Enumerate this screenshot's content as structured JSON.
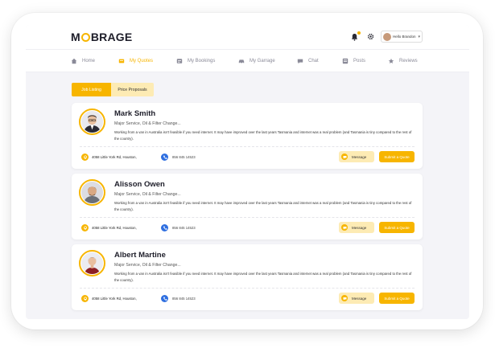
{
  "header": {
    "logo": {
      "part1": "M",
      "part2": "BRAGE"
    },
    "user_label": "Hello Brandon"
  },
  "nav": {
    "items": [
      {
        "label": "Home",
        "icon": "home-icon",
        "active": false
      },
      {
        "label": "My Quotes",
        "icon": "quotes-icon",
        "active": true
      },
      {
        "label": "My Bookings",
        "icon": "bookings-icon",
        "active": false
      },
      {
        "label": "My Garrage",
        "icon": "garage-icon",
        "active": false
      },
      {
        "label": "Chat",
        "icon": "chat-icon",
        "active": false
      },
      {
        "label": "Posts",
        "icon": "posts-icon",
        "active": false
      },
      {
        "label": "Reviews",
        "icon": "reviews-icon",
        "active": false
      }
    ]
  },
  "tabs": {
    "active": "Job Listing",
    "inactive": "Price Proposals"
  },
  "cards": [
    {
      "name": "Mark Smith",
      "service": "Major Service, Oil & Filter Change...",
      "description": "Working from a van in Australia isn't feasible if you need internet. It may have improved over the last years Tasmania and internet was a real problem (and Tasmania is tiny compared to the rest of the country).",
      "address": "4058 Little York Rd, Houston,",
      "phone": "856 845 14523",
      "message_label": "Message",
      "quote_label": "Submit a Quote"
    },
    {
      "name": "Alisson Owen",
      "service": "Major Service, Oil & Filter Change...",
      "description": "Working from a van in Australia isn't feasible if you need internet. It may have improved over the last years Tasmania and internet was a real problem (and Tasmania is tiny compared to the rest of the country).",
      "address": "4058 Little York Rd, Houston,",
      "phone": "856 845 14523",
      "message_label": "Message",
      "quote_label": "Submit a Quote"
    },
    {
      "name": "Albert Martine",
      "service": "Major Service, Oil & Filter Change...",
      "description": "Working from a van in Australia isn't feasible if you need internet. It may have improved over the last years Tasmania and internet was a real problem (and Tasmania is tiny compared to the rest of the country).",
      "address": "4058 Little York Rd, Houston,",
      "phone": "856 845 14523",
      "message_label": "Message",
      "quote_label": "Submit a Quote"
    }
  ],
  "colors": {
    "accent": "#f7b500",
    "accent_light": "#fdebb4",
    "phone_blue": "#2f6fe0",
    "background": "#f4f4f8"
  }
}
